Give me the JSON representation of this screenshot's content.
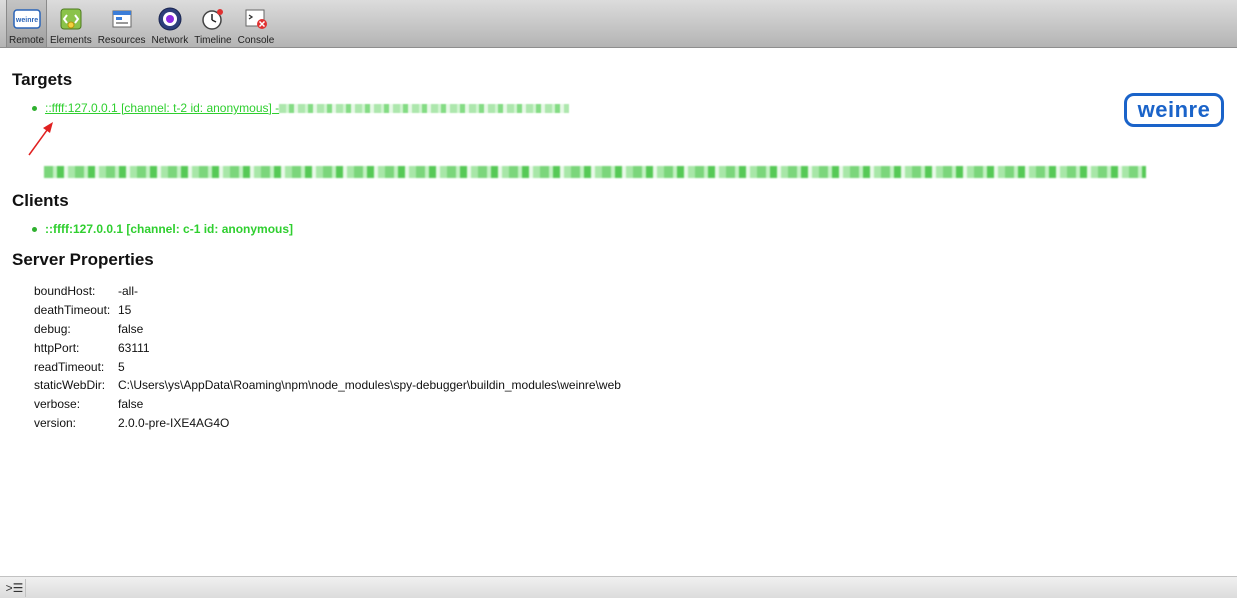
{
  "toolbar": {
    "items": [
      {
        "label": "Remote",
        "icon": "weinre-logo-icon"
      },
      {
        "label": "Elements",
        "icon": "elements-icon"
      },
      {
        "label": "Resources",
        "icon": "resources-icon"
      },
      {
        "label": "Network",
        "icon": "network-icon"
      },
      {
        "label": "Timeline",
        "icon": "timeline-icon"
      },
      {
        "label": "Console",
        "icon": "console-icon"
      }
    ],
    "active": "Remote",
    "remote_icon_text": "weinre"
  },
  "sections": {
    "targets": "Targets",
    "clients": "Clients",
    "server_properties": "Server Properties"
  },
  "targets": [
    {
      "text": "::ffff:127.0.0.1 [channel: t-2 id: anonymous] - "
    }
  ],
  "clients": [
    {
      "text": "::ffff:127.0.0.1 [channel: c-1 id: anonymous]"
    }
  ],
  "server_properties": [
    {
      "key": "boundHost:",
      "value": "-all-"
    },
    {
      "key": "deathTimeout:",
      "value": "15"
    },
    {
      "key": "debug:",
      "value": "false"
    },
    {
      "key": "httpPort:",
      "value": "63111"
    },
    {
      "key": "readTimeout:",
      "value": "5"
    },
    {
      "key": "staticWebDir:",
      "value": "C:\\Users\\ys\\AppData\\Roaming\\npm\\node_modules\\spy-debugger\\buildin_modules\\weinre\\web"
    },
    {
      "key": "verbose:",
      "value": "false"
    },
    {
      "key": "version:",
      "value": "2.0.0-pre-IXE4AG4O"
    }
  ],
  "logo": "weinre",
  "statusbar": {
    "console_icon": "console-toggle-icon",
    "console_glyph": ">☰"
  },
  "colors": {
    "link_green": "#2fcf2f",
    "logo_blue": "#1a63c9",
    "annotation_red": "#e02020"
  }
}
